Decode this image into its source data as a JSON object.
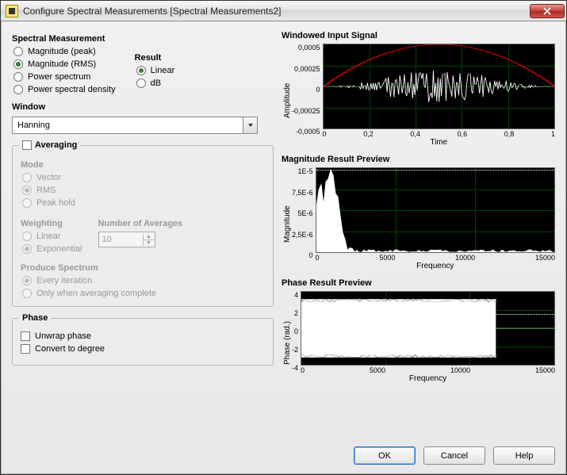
{
  "titlebar": {
    "title": "Configure Spectral Measurements [Spectral Measurements2]"
  },
  "spectral": {
    "heading": "Spectral Measurement",
    "mag_peak": "Magnitude (peak)",
    "mag_rms": "Magnitude (RMS)",
    "power_spectrum": "Power spectrum",
    "psd": "Power spectral density",
    "result_heading": "Result",
    "linear": "Linear",
    "db": "dB"
  },
  "window": {
    "heading": "Window",
    "value": "Hanning"
  },
  "averaging": {
    "heading": "Averaging",
    "mode_heading": "Mode",
    "vector": "Vector",
    "rms": "RMS",
    "peak_hold": "Peak hold",
    "weighting_heading": "Weighting",
    "linear": "Linear",
    "exponential": "Exponential",
    "num_avg_heading": "Number of Averages",
    "num_avg_value": "10",
    "produce_heading": "Produce Spectrum",
    "every_iter": "Every iteration",
    "only_complete": "Only when averaging complete"
  },
  "phase_opts": {
    "heading": "Phase",
    "unwrap": "Unwrap phase",
    "convert": "Convert to degree"
  },
  "charts": {
    "windowed": {
      "title": "Windowed Input Signal",
      "ylabel": "Amplitude",
      "xlabel": "Time",
      "yticks": [
        "0,0005",
        "0,00025",
        "0",
        "-0,00025",
        "-0,0005"
      ],
      "xticks": [
        "0",
        "0,2",
        "0,4",
        "0,6",
        "0,8",
        "1"
      ]
    },
    "magnitude": {
      "title": "Magnitude Result Preview",
      "ylabel": "Magnitude",
      "xlabel": "Frequency",
      "yticks": [
        "1E-5",
        "7,5E-6",
        "5E-6",
        "2,5E-6",
        "0"
      ],
      "xticks": [
        "0",
        "5000",
        "10000",
        "15000"
      ]
    },
    "phase": {
      "title": "Phase Result Preview",
      "ylabel": "Phase (rad.)",
      "xlabel": "Frequency",
      "yticks": [
        "4",
        "2",
        "0",
        "-2",
        "-4"
      ],
      "xticks": [
        "0",
        "5000",
        "10000",
        "15000"
      ]
    }
  },
  "buttons": {
    "ok": "OK",
    "cancel": "Cancel",
    "help": "Help"
  },
  "chart_data": [
    {
      "type": "line",
      "title": "Windowed Input Signal",
      "xlabel": "Time",
      "ylabel": "Amplitude",
      "xlim": [
        0,
        1
      ],
      "ylim": [
        -0.0005,
        0.0005
      ],
      "series": [
        {
          "name": "window-envelope",
          "note": "Hanning window envelope peaking ~0.0005 at t=0.5"
        },
        {
          "name": "signal",
          "note": "noisy windowed input, amplitude envelope following window shape, max ~±0.0002"
        }
      ]
    },
    {
      "type": "line",
      "title": "Magnitude Result Preview",
      "xlabel": "Frequency",
      "ylabel": "Magnitude",
      "xlim": [
        0,
        15000
      ],
      "ylim": [
        0,
        1e-05
      ],
      "series": [
        {
          "name": "magnitude",
          "note": "dominant peak near ~900 Hz at ~1e-5, multiple decaying peaks below ~3000, near zero above 4000; dotted reference line at 1e-5"
        }
      ]
    },
    {
      "type": "line",
      "title": "Phase Result Preview",
      "xlabel": "Frequency",
      "ylabel": "Phase (rad.)",
      "xlim": [
        0,
        15000
      ],
      "ylim": [
        -4,
        4
      ],
      "series": [
        {
          "name": "phase",
          "note": "wrapped phase oscillating between ~-3.14 and ~3.14 up to ~11500 Hz, flat ~0 beyond; dotted reference near +1.5"
        }
      ]
    }
  ]
}
